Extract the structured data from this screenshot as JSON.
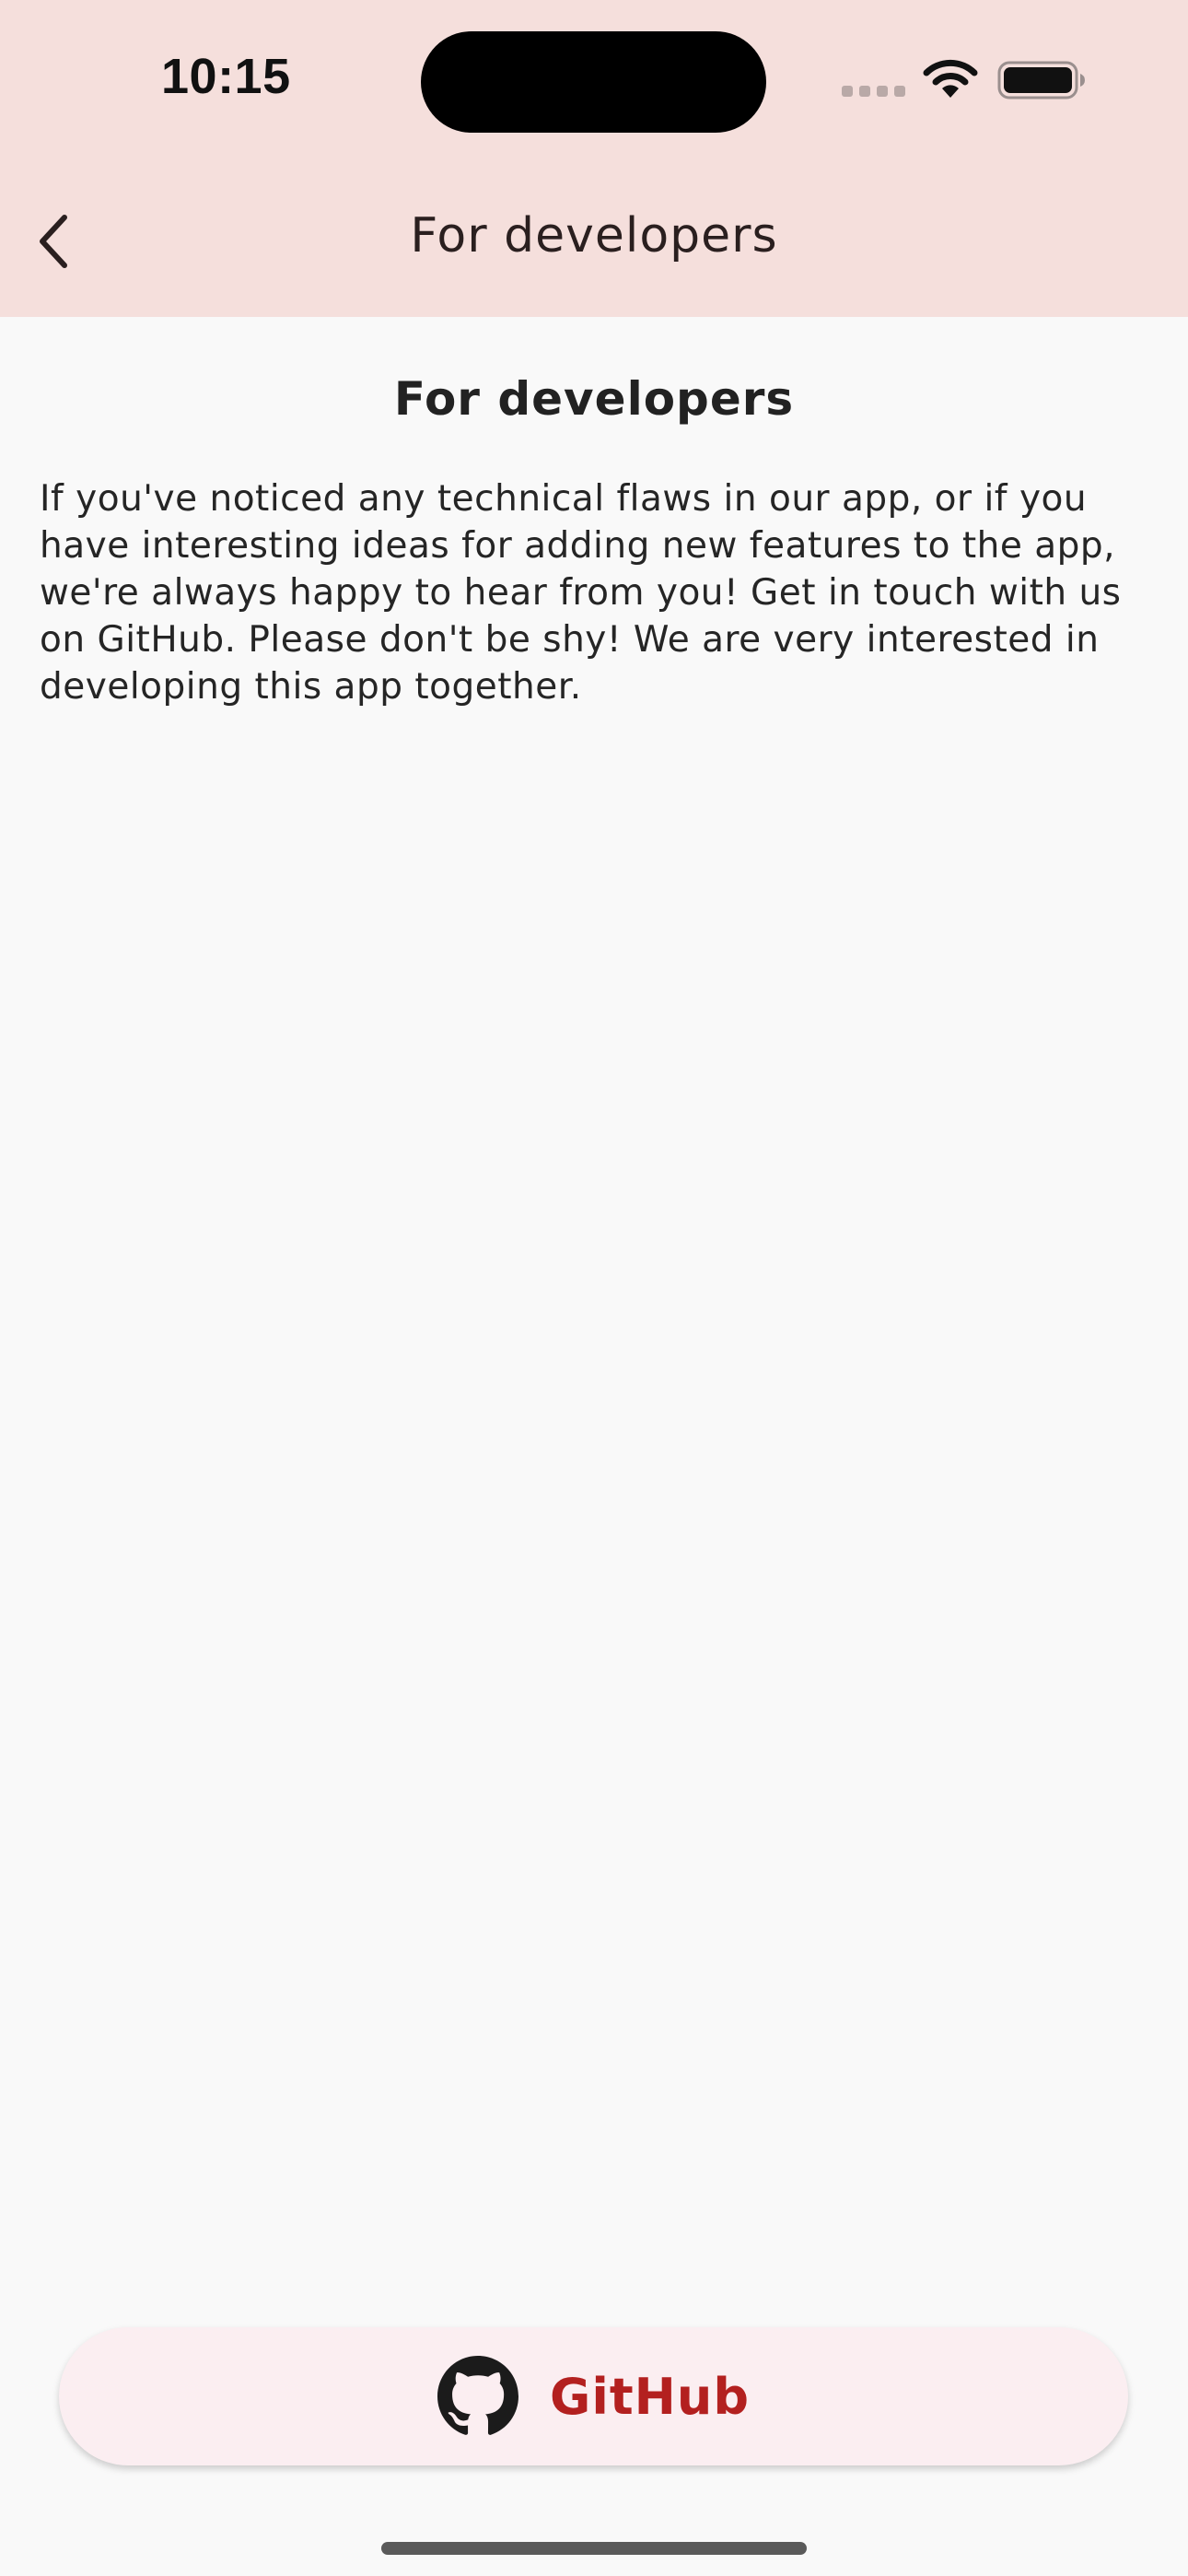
{
  "status_bar": {
    "time": "10:15",
    "signal_icon": "cellular-signal-icon",
    "wifi_icon": "wifi-icon",
    "battery_icon": "battery-icon"
  },
  "nav_bar": {
    "back_icon": "chevron-left-icon",
    "title": "For developers"
  },
  "content": {
    "heading": "For developers",
    "body": "If you've noticed any technical flaws in our app, or if you have interesting ideas for adding new features to the app, we're always happy to hear from you! Get in touch with us on GitHub. Please don't be shy! We are very interested in developing this app together."
  },
  "github_button": {
    "icon": "github-icon",
    "label": "GitHub"
  },
  "colors": {
    "header_background": "#f5dfdc",
    "page_background": "#f9f9f9",
    "button_background": "#fbeef1",
    "accent": "#b3201f"
  }
}
